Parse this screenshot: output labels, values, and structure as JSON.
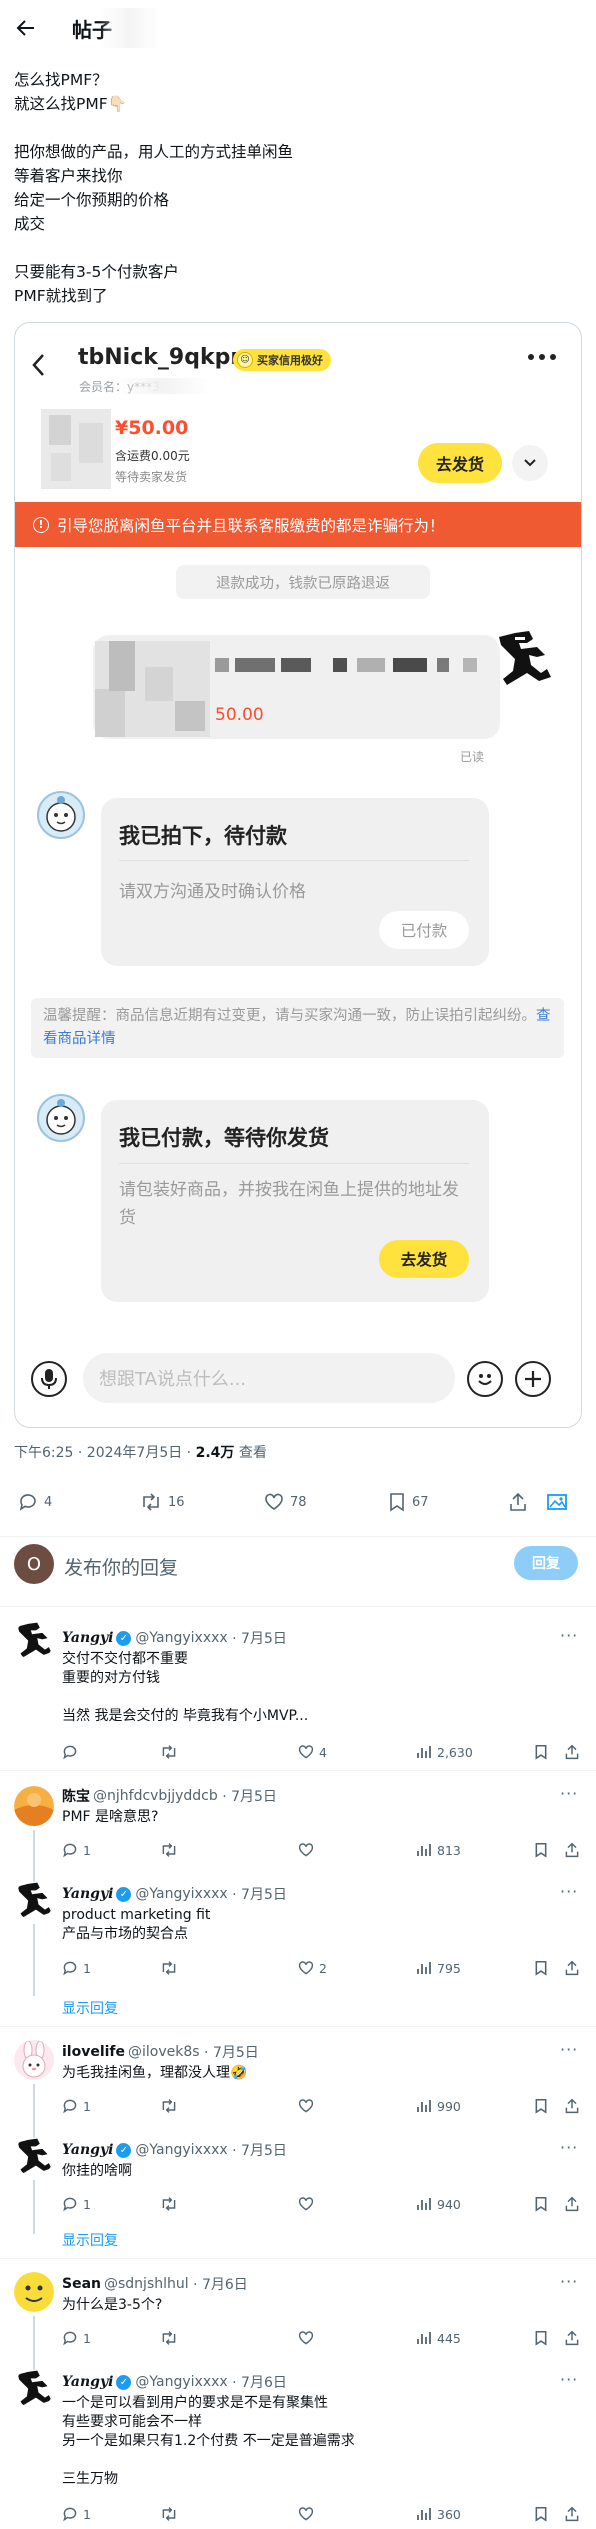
{
  "header": {
    "title": "帖子"
  },
  "tweet": {
    "lines": [
      "怎么找PMF？",
      "就这么找PMF👇🏻",
      "",
      "把你想做的产品，用人工的方式挂单闲鱼",
      "等着客户来找你",
      "给定一个你预期的价格",
      "成交",
      "",
      "只要能有3-5个付款客户",
      "PMF就找到了"
    ],
    "meta_time": "下午6:25 · 2024年7月5日 · ",
    "meta_views": "2.4万",
    "meta_views_label": " 查看",
    "stats": {
      "replies": "4",
      "retweets": "16",
      "likes": "78",
      "bookmarks": "67"
    }
  },
  "card": {
    "seller_name": "tbNick_9qkpm",
    "badge": "买家信用极好",
    "member_label": "会员名：",
    "member_id": "y***3",
    "price": "¥50.00",
    "shipping": "含运费0.00元",
    "waiting": "等待卖家发货",
    "ship_button": "去发货",
    "warning": "引导您脱离闲鱼平台并且联系客服缴费的都是诈骗行为！",
    "status": "退款成功，钱款已原路退返",
    "item_price": "50.00",
    "read_label": "已读",
    "msg1_title": "我已拍下，待付款",
    "msg1_body": "请双方沟通及时确认价格",
    "msg1_button": "已付款",
    "tip_prefix": "温馨提醒：商品信息近期有过变更，请与买家沟通一致，防止误拍引起纠纷。",
    "tip_link": "查看商品详情",
    "msg2_title": "我已付款，等待你发货",
    "msg2_body": "请包装好商品，并按我在闲鱼上提供的地址发货",
    "msg2_button": "去发货",
    "input_placeholder": "想跟TA说点什么..."
  },
  "compose": {
    "avatar_letter": "O",
    "placeholder": "发布你的回复",
    "button": "回复"
  },
  "replies": {
    "r1": {
      "name": "Yangyi",
      "handle": "@Yangyixxxx",
      "date": "· 7月5日",
      "lines": [
        "交付不交付都不重要",
        "重要的对方付钱",
        "",
        "当然 我是会交付的 毕竟我有个小MVP..."
      ],
      "replies": "",
      "retweets": "",
      "likes": "4",
      "views": "2,630"
    },
    "r2": {
      "name": "陈宝",
      "handle": "@njhfdcvbjjyddcb",
      "date": "· 7月5日",
      "lines": [
        "PMF 是啥意思?"
      ],
      "replies": "1",
      "retweets": "",
      "likes": "",
      "views": "813"
    },
    "r3": {
      "name": "Yangyi",
      "handle": "@Yangyixxxx",
      "date": "· 7月5日",
      "lines": [
        "product marketing fit",
        "产品与市场的契合点"
      ],
      "replies": "1",
      "retweets": "",
      "likes": "2",
      "views": "795"
    },
    "show_replies": "显示回复",
    "r4": {
      "name": "ilovelife",
      "handle": "@ilovek8s",
      "date": "· 7月5日",
      "lines": [
        "为毛我挂闲鱼，理都没人理🤣"
      ],
      "replies": "1",
      "retweets": "",
      "likes": "",
      "views": "990"
    },
    "r5": {
      "name": "Yangyi",
      "handle": "@Yangyixxxx",
      "date": "· 7月5日",
      "lines": [
        "你挂的啥啊"
      ],
      "replies": "1",
      "retweets": "",
      "likes": "",
      "views": "940"
    },
    "show_replies2": "显示回复",
    "r6": {
      "name": "Sean",
      "handle": "@sdnjshlhul",
      "date": "· 7月6日",
      "lines": [
        "为什么是3-5个?"
      ],
      "replies": "1",
      "retweets": "",
      "likes": "",
      "views": "445"
    },
    "r7": {
      "name": "Yangyi",
      "handle": "@Yangyixxxx",
      "date": "· 7月6日",
      "lines": [
        "一个是可以看到用户的要求是不是有聚集性",
        "有些要求可能会不一样",
        "另一个是如果只有1.2个付费 不一定是普遍需求",
        "",
        "三生万物"
      ],
      "replies": "1",
      "retweets": "",
      "likes": "",
      "views": "360"
    }
  },
  "colors": {
    "accent": "#1d9bf0",
    "xianyu_yellow": "#ffe23d",
    "warning_red": "#f05a33",
    "price_red": "#ff4d2e"
  }
}
